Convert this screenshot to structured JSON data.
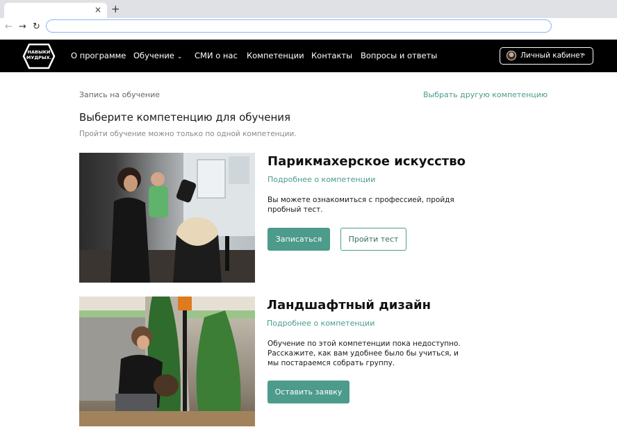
{
  "browser": {
    "tab_close": "×",
    "new_tab": "+",
    "back": "←",
    "forward": "→",
    "reload": "↻",
    "address_value": ""
  },
  "header": {
    "logo_text": "НАВЫКИ МУДРЫХ.",
    "nav": [
      {
        "label": "О программе"
      },
      {
        "label": "Обучение",
        "has_dropdown": true
      },
      {
        "label": "СМИ о нас"
      },
      {
        "label": "Компетенции"
      },
      {
        "label": "Контакты"
      },
      {
        "label": "Вопросы и ответы"
      }
    ],
    "chevron": "⌄",
    "account_label": "Личный кабинет"
  },
  "page": {
    "breadcrumb": "Запись на обучение",
    "other_link": "Выбрать другую компетенцию",
    "title": "Выберите компетенцию для обучения",
    "subtitle": "Пройти обучение можно только по одной компетенции."
  },
  "cards": [
    {
      "title": "Парикмахерское искусство",
      "more_link": "Подробнее о компетенции",
      "description": "Вы можете ознакомиться с профессией, пройдя пробный тест.",
      "primary_button": "Записаться",
      "secondary_button": "Пройти тест"
    },
    {
      "title": "Ландшафтный дизайн",
      "more_link": "Подробнее о компетенции",
      "description": "Обучение по этой компетенции пока недоступно. Расскажите, как вам удобнее было бы учиться, и мы постараемся собрать группу.",
      "primary_button": "Оставить заявку"
    }
  ],
  "colors": {
    "accent": "#4d9b8b",
    "header_bg": "#000000"
  }
}
